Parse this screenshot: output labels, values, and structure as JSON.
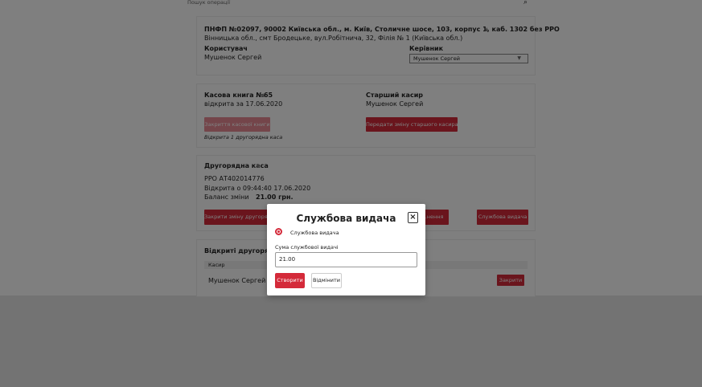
{
  "search": {
    "placeholder": "Пошук операції"
  },
  "company": {
    "title": "ПНФП №02097, 90002 Київська обл., м. Київ, Столичне шосе, 103, корпус 1, каб. 1302 без РРО",
    "address": "Вінницька обл., смт Бродецьке, вул.Робітнича, 32, Філія № 1 (Київська обл.)",
    "user_label": "Користувач",
    "user_value": "Мушенок Сергей",
    "manager_label": "Керівник",
    "manager_selected": "Мушенок Сергей"
  },
  "cashbook": {
    "title": "Касова книга №65",
    "opened": "відкрита за 17.06.2020",
    "senior_label": "Старший касир",
    "senior_value": "Мушенок Сергей",
    "close_button": "Закриття касової книги",
    "transfer_button": "Передати зміну старшого касира",
    "note": "Відкрита 1 другорядна каса"
  },
  "secondary": {
    "title": "Другорядна каса",
    "rro": "РРО АТ402014776",
    "opened": "Відкрита о 09:44:40 17.06.2020",
    "balance_label": "Баланс зміни",
    "balance_value": "21.00 грн.",
    "close_shift_button": "Закрити зміну другорядної",
    "collection_button": "...нення",
    "service_button": "Службова видача"
  },
  "open_secondary": {
    "title": "Відкриті другорядні к...",
    "column_cashier": "Касир",
    "row_cashier": "Мушенок Сергей",
    "close_button": "Закрити"
  },
  "modal": {
    "title": "Службова видача",
    "radio_label": "Службова видача",
    "amount_label": "Сума службової видачі",
    "amount_value": "21.00",
    "create_button": "Створити",
    "cancel_button": "Відмінити",
    "close_glyph": "×"
  },
  "colors": {
    "accent": "#d42a3a",
    "accent_disabled": "#e88a95",
    "overlay": "rgba(0,0,0,0.5)"
  }
}
